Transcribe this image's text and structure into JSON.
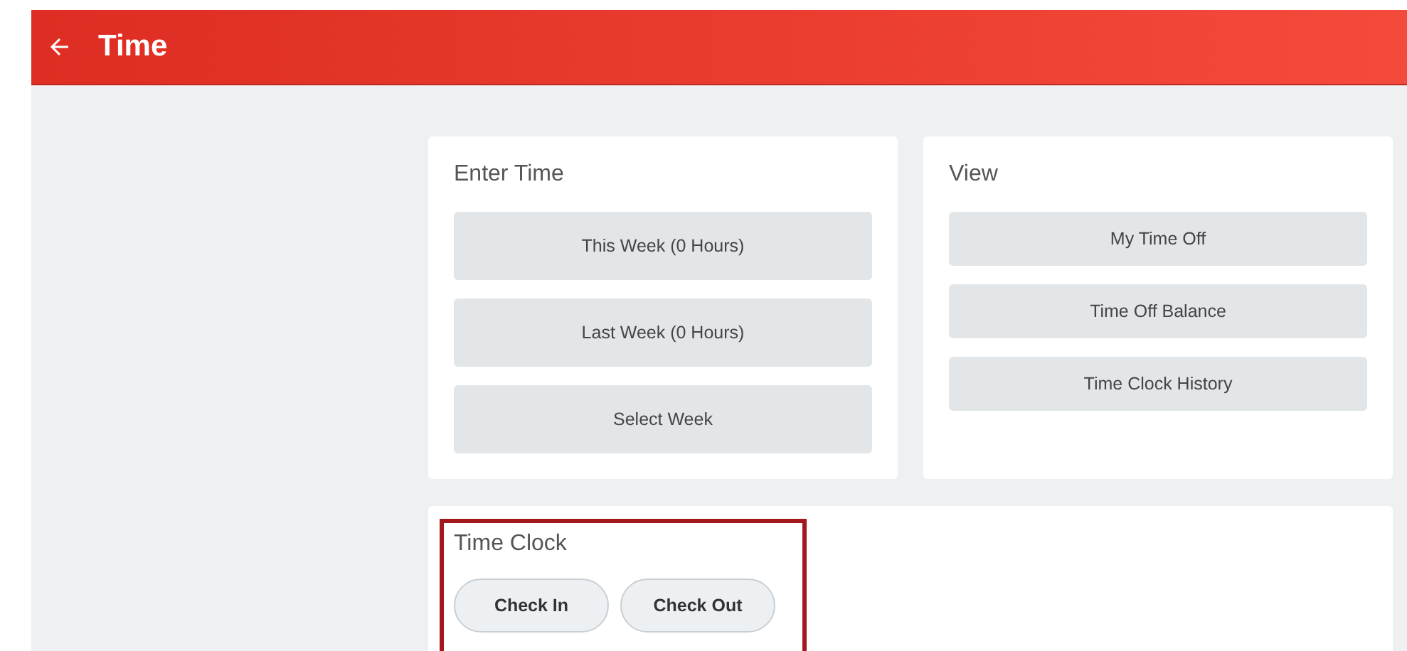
{
  "header": {
    "title": "Time"
  },
  "cards": [
    {
      "title": "Enter Time",
      "kind": "tall",
      "buttons": [
        "This Week (0 Hours)",
        "Last Week (0 Hours)",
        "Select Week"
      ]
    },
    {
      "title": "View",
      "kind": "short",
      "buttons": [
        "My Time Off",
        "Time Off Balance",
        "Time Clock History"
      ]
    }
  ],
  "time_clock": {
    "title": "Time Clock",
    "highlighted": true,
    "buttons": [
      "Check In",
      "Check Out"
    ]
  }
}
